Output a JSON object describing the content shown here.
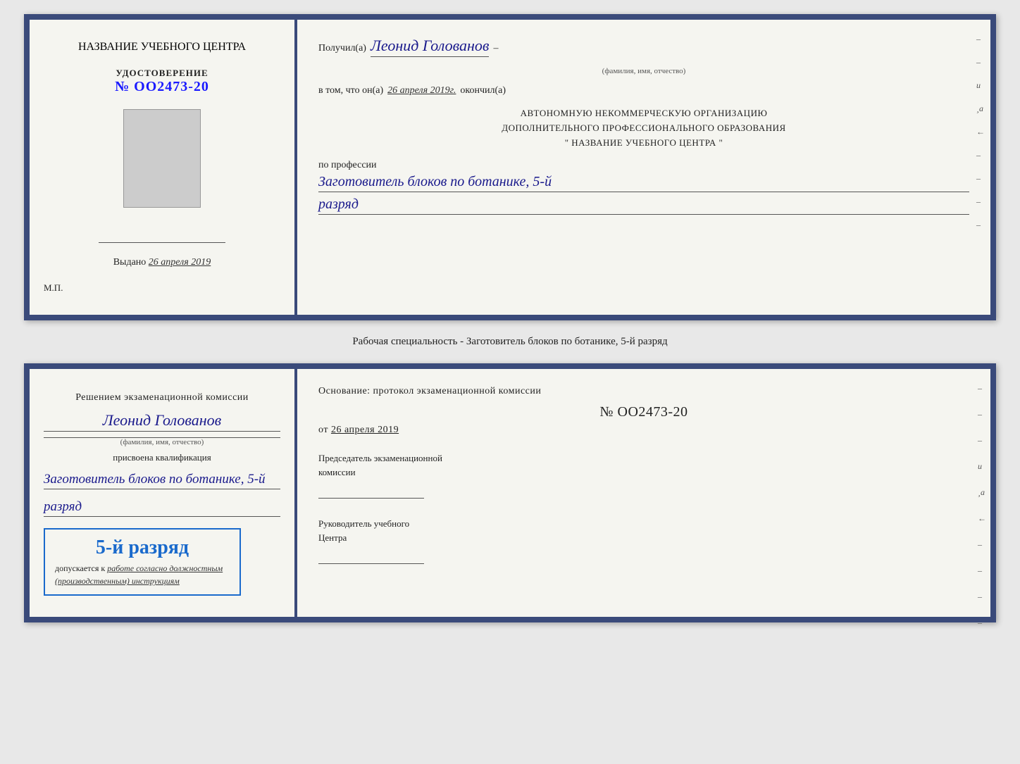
{
  "top_cert": {
    "left": {
      "title": "НАЗВАНИЕ УЧЕБНОГО ЦЕНТРА",
      "udostoverenie_label": "УДОСТОВЕРЕНИЕ",
      "number": "№ OO2473-20",
      "vydano_label": "Выдано",
      "vydano_date": "26 апреля 2019",
      "mp_label": "М.П."
    },
    "right": {
      "poluchil": "Получил(а)",
      "name": "Леонид Голованов",
      "dash": "–",
      "fio_caption": "(фамилия, имя, отчество)",
      "v_tom": "в том, что он(а)",
      "date_okончил": "26 апреля 2019г.",
      "okonchil": "окончил(а)",
      "avt_line1": "АВТОНОМНУЮ НЕКОММЕРЧЕСКУЮ ОРГАНИЗАЦИЮ",
      "avt_line2": "ДОПОЛНИТЕЛЬНОГО ПРОФЕССИОНАЛЬНОГО ОБРАЗОВАНИЯ",
      "avt_line3": "\"  НАЗВАНИЕ УЧЕБНОГО ЦЕНТРА  \"",
      "po_professii": "по профессии",
      "profession": "Заготовитель блоков по ботанике, 5-й",
      "razryad": "разряд"
    }
  },
  "specialty_label": "Рабочая специальность - Заготовитель блоков по ботанике, 5-й разряд",
  "bottom_cert": {
    "left": {
      "reshen": "Решением экзаменационной комиссии",
      "name": "Леонид Голованов",
      "fio_caption": "(фамилия, имя, отчество)",
      "prisvoena": "присвоена квалификация",
      "kval": "Заготовитель блоков по ботанике, 5-й",
      "razryad": "разряд",
      "stamp_rank": "5-й разряд",
      "dopusk_prefix": "допускается к",
      "dopusk_italic": "работе согласно должностным",
      "dopusk_italic2": "(производственным) инструкциям"
    },
    "right": {
      "osnovanie": "Основание: протокол экзаменационной комиссии",
      "number": "№  OO2473-20",
      "ot_label": "от",
      "ot_date": "26 апреля 2019",
      "chairman_label": "Председатель экзаменационной",
      "chairman_label2": "комиссии",
      "rukov_label": "Руководитель учебного",
      "rukov_label2": "Центра"
    }
  }
}
